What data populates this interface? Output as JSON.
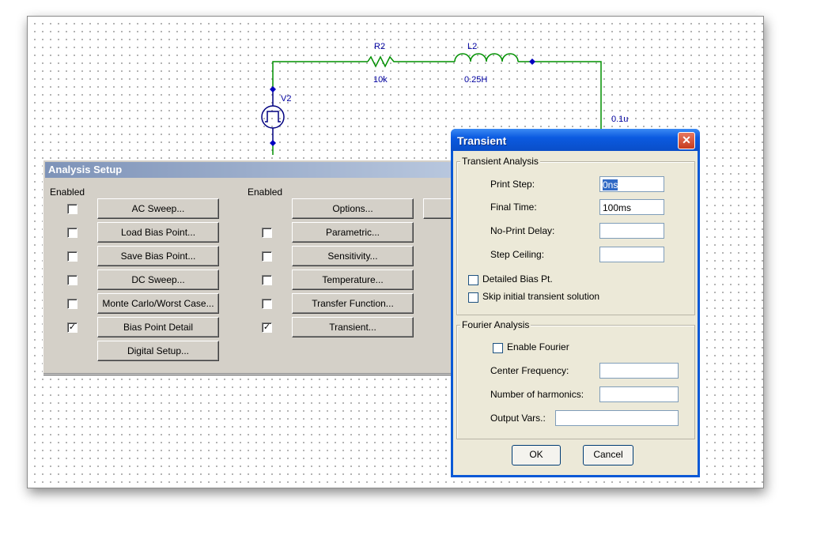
{
  "schematic": {
    "r2_name": "R2",
    "r2_value": "10k",
    "l2_name": "L2",
    "l2_value": "0.25H",
    "v2_name": "V2",
    "c_value": "0.1u"
  },
  "analysis_setup": {
    "title": "Analysis Setup",
    "enabled_label_left": "Enabled",
    "enabled_label_right": "Enabled",
    "left_buttons": [
      {
        "label": "AC Sweep...",
        "has_checkbox": true,
        "checked": false
      },
      {
        "label": "Load Bias Point...",
        "has_checkbox": true,
        "checked": false
      },
      {
        "label": "Save Bias Point...",
        "has_checkbox": true,
        "checked": false
      },
      {
        "label": "DC Sweep...",
        "has_checkbox": true,
        "checked": false
      },
      {
        "label": "Monte Carlo/Worst Case...",
        "has_checkbox": true,
        "checked": false
      },
      {
        "label": "Bias Point Detail",
        "has_checkbox": true,
        "checked": true
      },
      {
        "label": "Digital Setup...",
        "has_checkbox": false,
        "checked": false
      }
    ],
    "right_buttons": [
      {
        "label": "Options...",
        "has_checkbox": false,
        "checked": false
      },
      {
        "label": "Parametric...",
        "has_checkbox": true,
        "checked": false
      },
      {
        "label": "Sensitivity...",
        "has_checkbox": true,
        "checked": false
      },
      {
        "label": "Temperature...",
        "has_checkbox": true,
        "checked": false
      },
      {
        "label": "Transfer Function...",
        "has_checkbox": true,
        "checked": false
      },
      {
        "label": "Transient...",
        "has_checkbox": true,
        "checked": true
      }
    ]
  },
  "transient": {
    "title": "Transient",
    "group_transient": "Transient Analysis",
    "print_step_label": "Print Step:",
    "print_step_value": "0ns",
    "final_time_label": "Final Time:",
    "final_time_value": "100ms",
    "no_print_delay_label": "No-Print Delay:",
    "no_print_delay_value": "",
    "step_ceiling_label": "Step Ceiling:",
    "step_ceiling_value": "",
    "detailed_bias_label": "Detailed Bias Pt.",
    "skip_initial_label": "Skip initial transient solution",
    "group_fourier": "Fourier Analysis",
    "enable_fourier_label": "Enable Fourier",
    "center_freq_label": "Center Frequency:",
    "center_freq_value": "",
    "harmonics_label": "Number of harmonics:",
    "harmonics_value": "",
    "output_vars_label": "Output Vars.:",
    "output_vars_value": "",
    "ok_label": "OK",
    "cancel_label": "Cancel"
  }
}
